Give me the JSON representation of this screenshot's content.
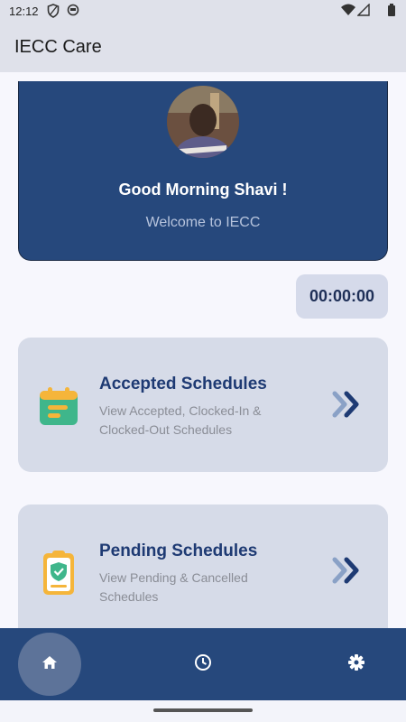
{
  "status_bar": {
    "time": "12:12"
  },
  "app_bar": {
    "title": "IECC Care"
  },
  "hero": {
    "greeting": "Good Morning Shavi !",
    "subtitle": "Welcome to IECC"
  },
  "timer": {
    "value": "00:00:00"
  },
  "cards": [
    {
      "title": "Accepted Schedules",
      "description": "View Accepted, Clocked-In & Clocked-Out Schedules",
      "icon": "calendar-icon"
    },
    {
      "title": "Pending Schedules",
      "description": "View Pending & Cancelled Schedules",
      "icon": "clipboard-shield-icon"
    }
  ],
  "bottom_nav": [
    {
      "icon": "home-icon",
      "active": true
    },
    {
      "icon": "clock-icon",
      "active": false
    },
    {
      "icon": "gear-icon",
      "active": false
    }
  ],
  "colors": {
    "primary": "#26487c",
    "card_bg": "#d6dbe8",
    "card_title": "#1e3a73",
    "active_nav": "#5d7399"
  }
}
